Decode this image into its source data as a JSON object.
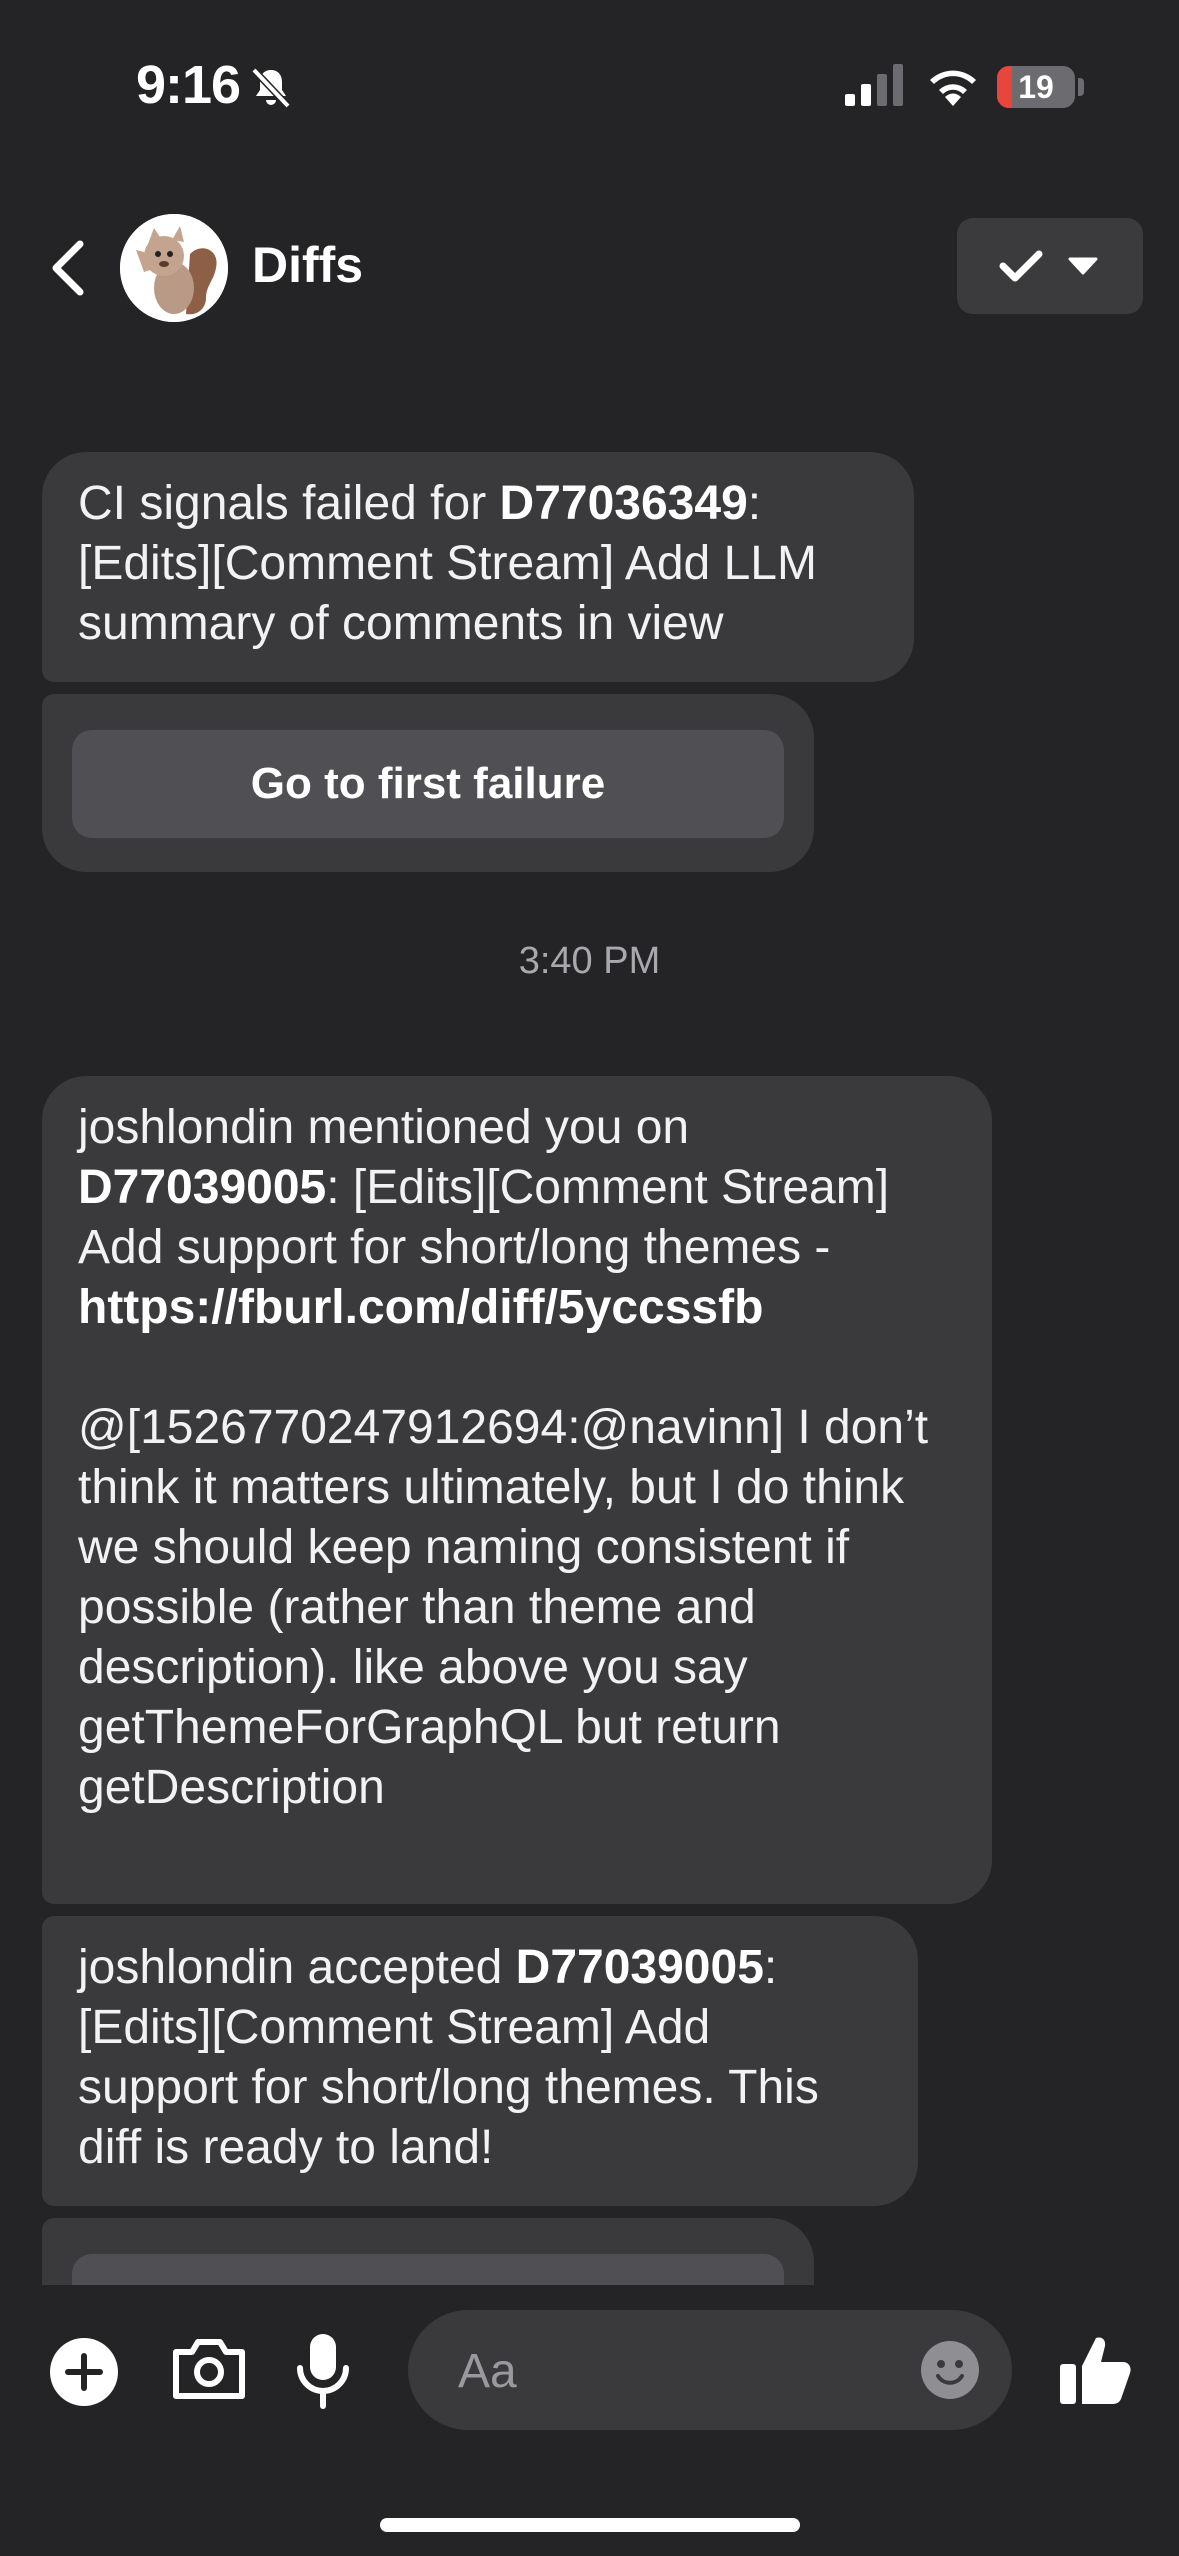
{
  "status": {
    "time": "9:16",
    "battery": "19",
    "battery_level": 0.19
  },
  "header": {
    "title": "Diffs"
  },
  "messages": {
    "m1": {
      "pre": "CI signals failed for ",
      "diff": "D77036349",
      "post": ": [Edits][Comment Stream] Add LLM summary of comments in view"
    },
    "m1_button": "Go to first failure",
    "timestamp": "3:40 PM",
    "m2": {
      "pre": "joshlondin mentioned you on ",
      "diff": "D77039005",
      "mid": ": [Edits][Comment Stream] Add support for short/long themes - ",
      "link": "https://fburl.com/diff/5yccssfb",
      "body": "@[1526770247912694:@navinn] I don’t think it matters ultimately, but I do think we should keep naming consistent if possible (rather than theme and description). like above you say getThemeForGraphQL but return getDescription"
    },
    "m3": {
      "pre": "joshlondin accepted ",
      "diff": "D77039005",
      "post": ": [Edits][Comment Stream] Add support for short/long themes. This diff is ready to land!"
    }
  },
  "composer": {
    "placeholder": "Aa"
  },
  "colors": {
    "background": "#242426",
    "bubble": "#3a3a3d",
    "button": "#505054",
    "battery_low": "#e8453c"
  },
  "icons": [
    "bell-slash-icon",
    "cellular-signal-icon",
    "wifi-icon",
    "battery-icon",
    "back-chevron-icon",
    "checkmark-icon",
    "dropdown-caret-icon",
    "plus-icon",
    "camera-icon",
    "microphone-icon",
    "emoji-icon",
    "thumbs-up-icon"
  ]
}
